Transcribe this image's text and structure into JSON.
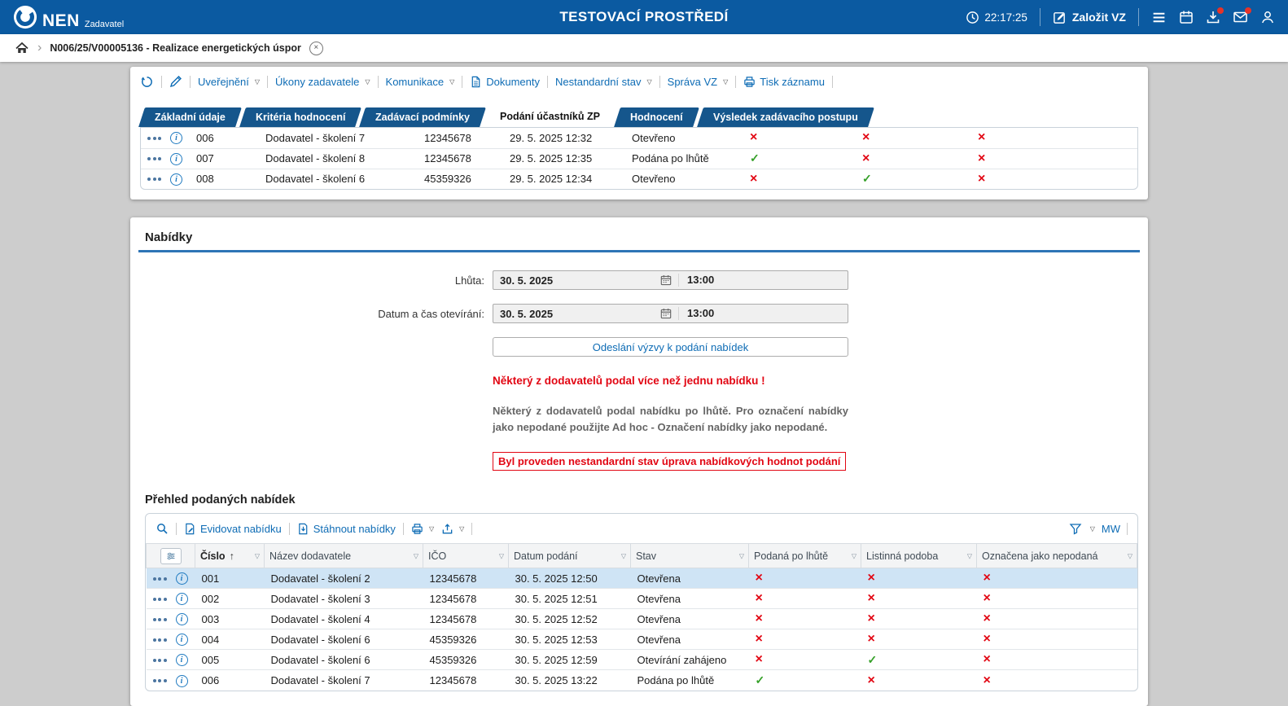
{
  "header": {
    "brand": "NEN",
    "brand_sub": "Zadavatel",
    "title": "TESTOVACÍ PROSTŘEDÍ",
    "time": "22:17:25",
    "create_button": "Založit VZ"
  },
  "breadcrumb": {
    "item": "N006/25/V00005136 - Realizace energetických úspor"
  },
  "record_toolbar": {
    "items": [
      {
        "label": "Uveřejnění",
        "caret": true
      },
      {
        "label": "Úkony zadavatele",
        "caret": true
      },
      {
        "label": "Komunikace",
        "caret": true
      },
      {
        "label": "Dokumenty",
        "caret": false
      },
      {
        "label": "Nestandardní stav",
        "caret": true
      },
      {
        "label": "Správa VZ",
        "caret": true
      },
      {
        "label": "Tisk záznamu",
        "caret": false
      }
    ]
  },
  "tabs": [
    {
      "label": "Základní údaje",
      "active": false
    },
    {
      "label": "Kritéria hodnocení",
      "active": false
    },
    {
      "label": "Zadávací podmínky",
      "active": false
    },
    {
      "label": "Podání účastníků ZP",
      "active": true
    },
    {
      "label": "Hodnocení",
      "active": false
    },
    {
      "label": "Výsledek zadávacího postupu",
      "active": false
    }
  ],
  "participants_table": {
    "rows": [
      {
        "cislo": "006",
        "nazev": "Dodavatel - školení 7",
        "ico": "12345678",
        "datum": "29. 5. 2025 12:32",
        "stav": "Otevřeno",
        "podana_po_lhute": false,
        "listinna_podoba": false,
        "oznacena_jako_nepodana": false,
        "selected": false
      },
      {
        "cislo": "007",
        "nazev": "Dodavatel - školení 8",
        "ico": "12345678",
        "datum": "29. 5. 2025 12:35",
        "stav": "Podána po lhůtě",
        "podana_po_lhute": true,
        "listinna_podoba": false,
        "oznacena_jako_nepodana": false,
        "selected": false
      },
      {
        "cislo": "008",
        "nazev": "Dodavatel - školení 6",
        "ico": "45359326",
        "datum": "29. 5. 2025 12:34",
        "stav": "Otevřeno",
        "podana_po_lhute": false,
        "listinna_podoba": true,
        "oznacena_jako_nepodana": false,
        "selected": false
      }
    ]
  },
  "offers_section": {
    "title": "Nabídky",
    "deadline_label": "Lhůta:",
    "deadline_date": "30. 5. 2025",
    "deadline_time": "13:00",
    "opening_label": "Datum a čas otevírání:",
    "opening_date": "30. 5. 2025",
    "opening_time": "13:00",
    "send_button": "Odeslání výzvy k podání nabídek",
    "warning_multiple": "Některý z dodavatelů podal více než jednu nabídku !",
    "info_late": "Některý z dodavatelů podal nabídku po lhůtě. Pro označení nabídky jako nepodané použijte Ad hoc - Označení nabídky jako nepodané.",
    "notice_nonstandard": "Byl proveden nestandardní stav úprava nabídkových hodnot podání"
  },
  "offers_table": {
    "title": "Přehled podaných nabídek",
    "toolbar": {
      "register_label": "Evidovat nabídku",
      "download_label": "Stáhnout nabídky",
      "user_link": "MW"
    },
    "columns": [
      "Číslo",
      "Název dodavatele",
      "IČO",
      "Datum podání",
      "Stav",
      "Podaná po lhůtě",
      "Listinná podoba",
      "Označena jako nepodaná"
    ],
    "sort": {
      "column": "Číslo",
      "direction": "asc"
    },
    "rows": [
      {
        "cislo": "001",
        "nazev": "Dodavatel - školení 2",
        "ico": "12345678",
        "datum": "30. 5. 2025 12:50",
        "stav": "Otevřena",
        "podana_po_lhute": false,
        "listinna_podoba": false,
        "oznacena_jako_nepodana": false,
        "selected": true
      },
      {
        "cislo": "002",
        "nazev": "Dodavatel - školení 3",
        "ico": "12345678",
        "datum": "30. 5. 2025 12:51",
        "stav": "Otevřena",
        "podana_po_lhute": false,
        "listinna_podoba": false,
        "oznacena_jako_nepodana": false,
        "selected": false
      },
      {
        "cislo": "003",
        "nazev": "Dodavatel - školení 4",
        "ico": "12345678",
        "datum": "30. 5. 2025 12:52",
        "stav": "Otevřena",
        "podana_po_lhute": false,
        "listinna_podoba": false,
        "oznacena_jako_nepodana": false,
        "selected": false
      },
      {
        "cislo": "004",
        "nazev": "Dodavatel - školení 6",
        "ico": "45359326",
        "datum": "30. 5. 2025 12:53",
        "stav": "Otevřena",
        "podana_po_lhute": false,
        "listinna_podoba": false,
        "oznacena_jako_nepodana": false,
        "selected": false
      },
      {
        "cislo": "005",
        "nazev": "Dodavatel - školení 6",
        "ico": "45359326",
        "datum": "30. 5. 2025 12:59",
        "stav": "Otevírání zahájeno",
        "podana_po_lhute": false,
        "listinna_podoba": true,
        "oznacena_jako_nepodana": false,
        "selected": false
      },
      {
        "cislo": "006",
        "nazev": "Dodavatel - školení 7",
        "ico": "12345678",
        "datum": "30. 5. 2025 13:22",
        "stav": "Podána po lhůtě",
        "podana_po_lhute": true,
        "listinna_podoba": false,
        "oznacena_jako_nepodana": false,
        "selected": false
      }
    ]
  },
  "glyphs": {
    "caret": "▽",
    "sort_asc": "↑",
    "breadcrumb_sep": "›",
    "close": "×",
    "info": "i",
    "mark_yes": "✓",
    "mark_no": "×"
  },
  "colors": {
    "header_blue": "#0b5aa1",
    "tab_blue": "#15568c",
    "link_blue": "#0e6cb5",
    "error_red": "#e20613",
    "success_green": "#35a028",
    "selected_row": "#cfe4f5"
  },
  "icons": {
    "nen-logo-icon": "ring-logo",
    "clock-icon": "clock",
    "create-vz-icon": "pencil-square",
    "menu-icon": "hamburger",
    "calendar-icon": "calendar",
    "download-icon": "download-tray",
    "mail-icon": "envelope",
    "user-icon": "person",
    "home-icon": "house",
    "close-icon": "circle-x",
    "undo-icon": "circular-arrow",
    "edit-icon": "pencil",
    "document-icon": "document",
    "printer-icon": "printer",
    "search-icon": "magnifier",
    "register-offer-icon": "document-pencil",
    "download-offers-icon": "document-arrow-down",
    "export-icon": "tray-arrow-up",
    "filter-icon": "funnel",
    "grid-settings-icon": "sliders",
    "row-menu-icon": "three-dots",
    "row-info-icon": "info-circle"
  }
}
